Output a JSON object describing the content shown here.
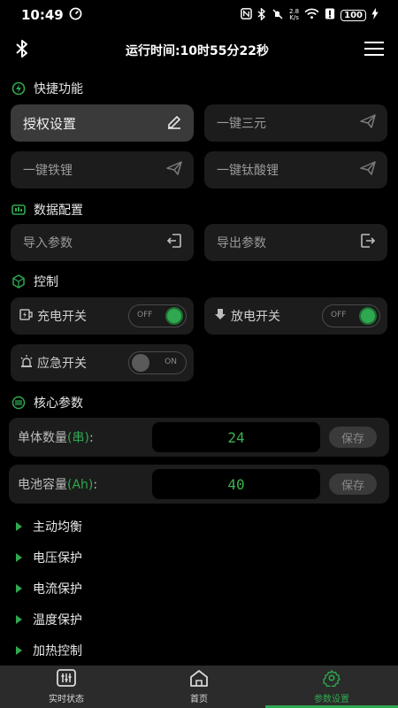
{
  "status_bar": {
    "time": "10:49",
    "network": "2.8\nK/s",
    "battery": "100"
  },
  "header": {
    "runtime": "运行时间:10时55分22秒"
  },
  "quick": {
    "title": "快捷功能",
    "items": [
      {
        "label": "授权设置"
      },
      {
        "label": "一键三元"
      },
      {
        "label": "一键铁锂"
      },
      {
        "label": "一键钛酸锂"
      }
    ]
  },
  "data_config": {
    "title": "数据配置",
    "import_label": "导入参数",
    "export_label": "导出参数"
  },
  "control": {
    "title": "控制",
    "charge": {
      "label": "充电开关",
      "state": "OFF"
    },
    "discharge": {
      "label": "放电开关",
      "state": "OFF"
    },
    "emergency": {
      "label": "应急开关",
      "state": "ON"
    }
  },
  "core": {
    "title": "核心参数",
    "rows": [
      {
        "label": "单体数量",
        "unit": "(串)",
        "value": "24",
        "save": "保存"
      },
      {
        "label": "电池容量",
        "unit": "(Ah)",
        "value": "40",
        "save": "保存"
      }
    ]
  },
  "sections": [
    {
      "label": "主动均衡"
    },
    {
      "label": "电压保护"
    },
    {
      "label": "电流保护"
    },
    {
      "label": "温度保护"
    },
    {
      "label": "加热控制"
    }
  ],
  "nav": [
    {
      "label": "实时状态"
    },
    {
      "label": "首页"
    },
    {
      "label": "参数设置"
    }
  ],
  "colors": {
    "accent": "#2fa84f",
    "background": "#000000",
    "card": "#1c1c1c"
  }
}
